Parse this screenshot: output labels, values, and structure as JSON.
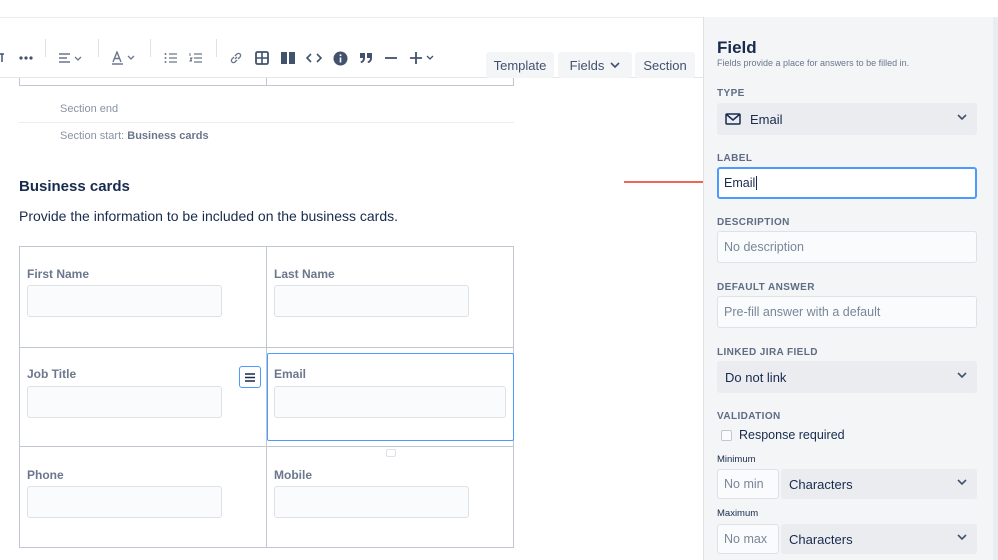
{
  "toolbar": {
    "template_label": "Template",
    "fields_label": "Fields",
    "section_label": "Section"
  },
  "editor": {
    "section_end": "Section end",
    "section_start_prefix": "Section start:",
    "section_start_name": "Business cards",
    "heading": "Business cards",
    "paragraph": "Provide the information to be included on the business cards.",
    "fields": {
      "first_name": "First Name",
      "last_name": "Last Name",
      "job_title": "Job Title",
      "email": "Email",
      "phone": "Phone",
      "mobile": "Mobile"
    }
  },
  "panel": {
    "title": "Field",
    "subtitle": "Fields provide a place for answers to be filled in.",
    "type_label": "TYPE",
    "type_value": "Email",
    "label_label": "LABEL",
    "label_value": "Email",
    "description_label": "DESCRIPTION",
    "description_placeholder": "No description",
    "default_label": "DEFAULT ANSWER",
    "default_placeholder": "Pre-fill answer with a default",
    "linked_label": "LINKED JIRA FIELD",
    "linked_value": "Do not link",
    "validation_label": "VALIDATION",
    "response_required": "Response required",
    "minimum_label": "Minimum",
    "min_placeholder": "No min",
    "min_unit": "Characters",
    "maximum_label": "Maximum",
    "max_placeholder": "No max",
    "max_unit": "Characters"
  },
  "colors": {
    "accent": "#4c9aff",
    "arrow": "#e5341a"
  }
}
